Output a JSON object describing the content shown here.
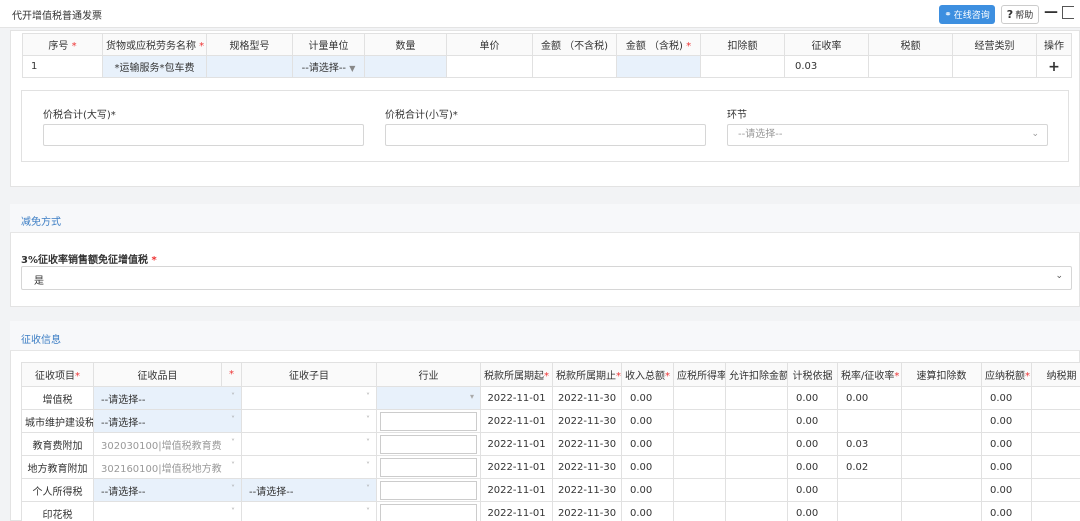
{
  "titlebar": {
    "title": "代开增值税普通发票",
    "consult_label": "在线咨询",
    "help_label": "帮助",
    "min_label": "—"
  },
  "goods_table": {
    "headers": [
      "序号",
      "货物或应税劳务名称",
      "规格型号",
      "计量单位",
      "数量",
      "单价",
      "金额 （不含税)",
      "金额 （含税)",
      "扣除额",
      "征收率",
      "税额",
      "经营类别",
      "操作"
    ],
    "required": [
      true,
      true,
      false,
      false,
      false,
      false,
      false,
      true,
      false,
      false,
      false,
      false,
      false
    ],
    "row": {
      "index": "1",
      "name": "*运输服务*包车费",
      "unit_placeholder": "--请选择--",
      "rate": "0.03",
      "action": "+"
    }
  },
  "totals": {
    "upper_label": "价税合计(大写)*",
    "lower_label": "价税合计(小写)*",
    "stage_label": "环节",
    "stage_placeholder": "--请选择--"
  },
  "reduction": {
    "section_title": "减免方式",
    "field_label": "3%征收率销售额免征增值税",
    "field_value": "是"
  },
  "collection": {
    "section_title": "征收信息",
    "headers": [
      "征收项目",
      "征收品目",
      "",
      "征收子目",
      "行业",
      "税款所属期起",
      "税款所属期止",
      "收入总额",
      "应税所得率",
      "允许扣除金额",
      "计税依据",
      "税率/征收率",
      "速算扣除数",
      "应纳税额",
      "纳税期"
    ],
    "required": [
      true,
      false,
      true,
      false,
      false,
      true,
      true,
      true,
      true,
      false,
      false,
      true,
      false,
      true,
      false
    ],
    "rows": [
      {
        "item": "增值税",
        "category": "--请选择--",
        "sub": "",
        "start": "2022-11-01",
        "end": "2022-11-30",
        "income": "0.00",
        "basis": "0.00",
        "rate": "0.00",
        "payable": "0.00"
      },
      {
        "item": "城市维护建设税",
        "category": "--请选择--",
        "sub": "",
        "start": "2022-11-01",
        "end": "2022-11-30",
        "income": "0.00",
        "basis": "0.00",
        "rate": "",
        "payable": "0.00"
      },
      {
        "item": "教育费附加",
        "category": "302030100|增值税教育费",
        "sub": "",
        "start": "2022-11-01",
        "end": "2022-11-30",
        "income": "0.00",
        "basis": "0.00",
        "rate": "0.03",
        "payable": "0.00"
      },
      {
        "item": "地方教育附加",
        "category": "302160100|增值税地方教",
        "sub": "",
        "start": "2022-11-01",
        "end": "2022-11-30",
        "income": "0.00",
        "basis": "0.00",
        "rate": "0.02",
        "payable": "0.00"
      },
      {
        "item": "个人所得税",
        "category": "--请选择--",
        "sub": "--请选择--",
        "start": "2022-11-01",
        "end": "2022-11-30",
        "income": "0.00",
        "basis": "0.00",
        "rate": "",
        "payable": "0.00"
      },
      {
        "item": "印花税",
        "category": "",
        "sub": "",
        "start": "2022-11-01",
        "end": "2022-11-30",
        "income": "0.00",
        "basis": "0.00",
        "rate": "",
        "payable": "0.00"
      }
    ]
  }
}
